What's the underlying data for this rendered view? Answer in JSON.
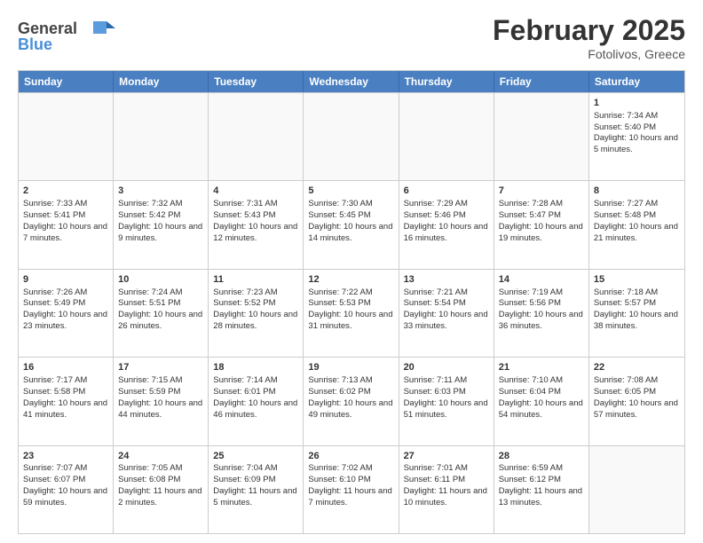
{
  "header": {
    "logo_general": "General",
    "logo_blue": "Blue",
    "month_title": "February 2025",
    "location": "Fotolivos, Greece"
  },
  "days_of_week": [
    "Sunday",
    "Monday",
    "Tuesday",
    "Wednesday",
    "Thursday",
    "Friday",
    "Saturday"
  ],
  "weeks": [
    [
      {
        "day": "",
        "info": "",
        "empty": true
      },
      {
        "day": "",
        "info": "",
        "empty": true
      },
      {
        "day": "",
        "info": "",
        "empty": true
      },
      {
        "day": "",
        "info": "",
        "empty": true
      },
      {
        "day": "",
        "info": "",
        "empty": true
      },
      {
        "day": "",
        "info": "",
        "empty": true
      },
      {
        "day": "1",
        "info": "Sunrise: 7:34 AM\nSunset: 5:40 PM\nDaylight: 10 hours and 5 minutes."
      }
    ],
    [
      {
        "day": "2",
        "info": "Sunrise: 7:33 AM\nSunset: 5:41 PM\nDaylight: 10 hours and 7 minutes."
      },
      {
        "day": "3",
        "info": "Sunrise: 7:32 AM\nSunset: 5:42 PM\nDaylight: 10 hours and 9 minutes."
      },
      {
        "day": "4",
        "info": "Sunrise: 7:31 AM\nSunset: 5:43 PM\nDaylight: 10 hours and 12 minutes."
      },
      {
        "day": "5",
        "info": "Sunrise: 7:30 AM\nSunset: 5:45 PM\nDaylight: 10 hours and 14 minutes."
      },
      {
        "day": "6",
        "info": "Sunrise: 7:29 AM\nSunset: 5:46 PM\nDaylight: 10 hours and 16 minutes."
      },
      {
        "day": "7",
        "info": "Sunrise: 7:28 AM\nSunset: 5:47 PM\nDaylight: 10 hours and 19 minutes."
      },
      {
        "day": "8",
        "info": "Sunrise: 7:27 AM\nSunset: 5:48 PM\nDaylight: 10 hours and 21 minutes."
      }
    ],
    [
      {
        "day": "9",
        "info": "Sunrise: 7:26 AM\nSunset: 5:49 PM\nDaylight: 10 hours and 23 minutes."
      },
      {
        "day": "10",
        "info": "Sunrise: 7:24 AM\nSunset: 5:51 PM\nDaylight: 10 hours and 26 minutes."
      },
      {
        "day": "11",
        "info": "Sunrise: 7:23 AM\nSunset: 5:52 PM\nDaylight: 10 hours and 28 minutes."
      },
      {
        "day": "12",
        "info": "Sunrise: 7:22 AM\nSunset: 5:53 PM\nDaylight: 10 hours and 31 minutes."
      },
      {
        "day": "13",
        "info": "Sunrise: 7:21 AM\nSunset: 5:54 PM\nDaylight: 10 hours and 33 minutes."
      },
      {
        "day": "14",
        "info": "Sunrise: 7:19 AM\nSunset: 5:56 PM\nDaylight: 10 hours and 36 minutes."
      },
      {
        "day": "15",
        "info": "Sunrise: 7:18 AM\nSunset: 5:57 PM\nDaylight: 10 hours and 38 minutes."
      }
    ],
    [
      {
        "day": "16",
        "info": "Sunrise: 7:17 AM\nSunset: 5:58 PM\nDaylight: 10 hours and 41 minutes."
      },
      {
        "day": "17",
        "info": "Sunrise: 7:15 AM\nSunset: 5:59 PM\nDaylight: 10 hours and 44 minutes."
      },
      {
        "day": "18",
        "info": "Sunrise: 7:14 AM\nSunset: 6:01 PM\nDaylight: 10 hours and 46 minutes."
      },
      {
        "day": "19",
        "info": "Sunrise: 7:13 AM\nSunset: 6:02 PM\nDaylight: 10 hours and 49 minutes."
      },
      {
        "day": "20",
        "info": "Sunrise: 7:11 AM\nSunset: 6:03 PM\nDaylight: 10 hours and 51 minutes."
      },
      {
        "day": "21",
        "info": "Sunrise: 7:10 AM\nSunset: 6:04 PM\nDaylight: 10 hours and 54 minutes."
      },
      {
        "day": "22",
        "info": "Sunrise: 7:08 AM\nSunset: 6:05 PM\nDaylight: 10 hours and 57 minutes."
      }
    ],
    [
      {
        "day": "23",
        "info": "Sunrise: 7:07 AM\nSunset: 6:07 PM\nDaylight: 10 hours and 59 minutes."
      },
      {
        "day": "24",
        "info": "Sunrise: 7:05 AM\nSunset: 6:08 PM\nDaylight: 11 hours and 2 minutes."
      },
      {
        "day": "25",
        "info": "Sunrise: 7:04 AM\nSunset: 6:09 PM\nDaylight: 11 hours and 5 minutes."
      },
      {
        "day": "26",
        "info": "Sunrise: 7:02 AM\nSunset: 6:10 PM\nDaylight: 11 hours and 7 minutes."
      },
      {
        "day": "27",
        "info": "Sunrise: 7:01 AM\nSunset: 6:11 PM\nDaylight: 11 hours and 10 minutes."
      },
      {
        "day": "28",
        "info": "Sunrise: 6:59 AM\nSunset: 6:12 PM\nDaylight: 11 hours and 13 minutes."
      },
      {
        "day": "",
        "info": "",
        "empty": true
      }
    ]
  ]
}
